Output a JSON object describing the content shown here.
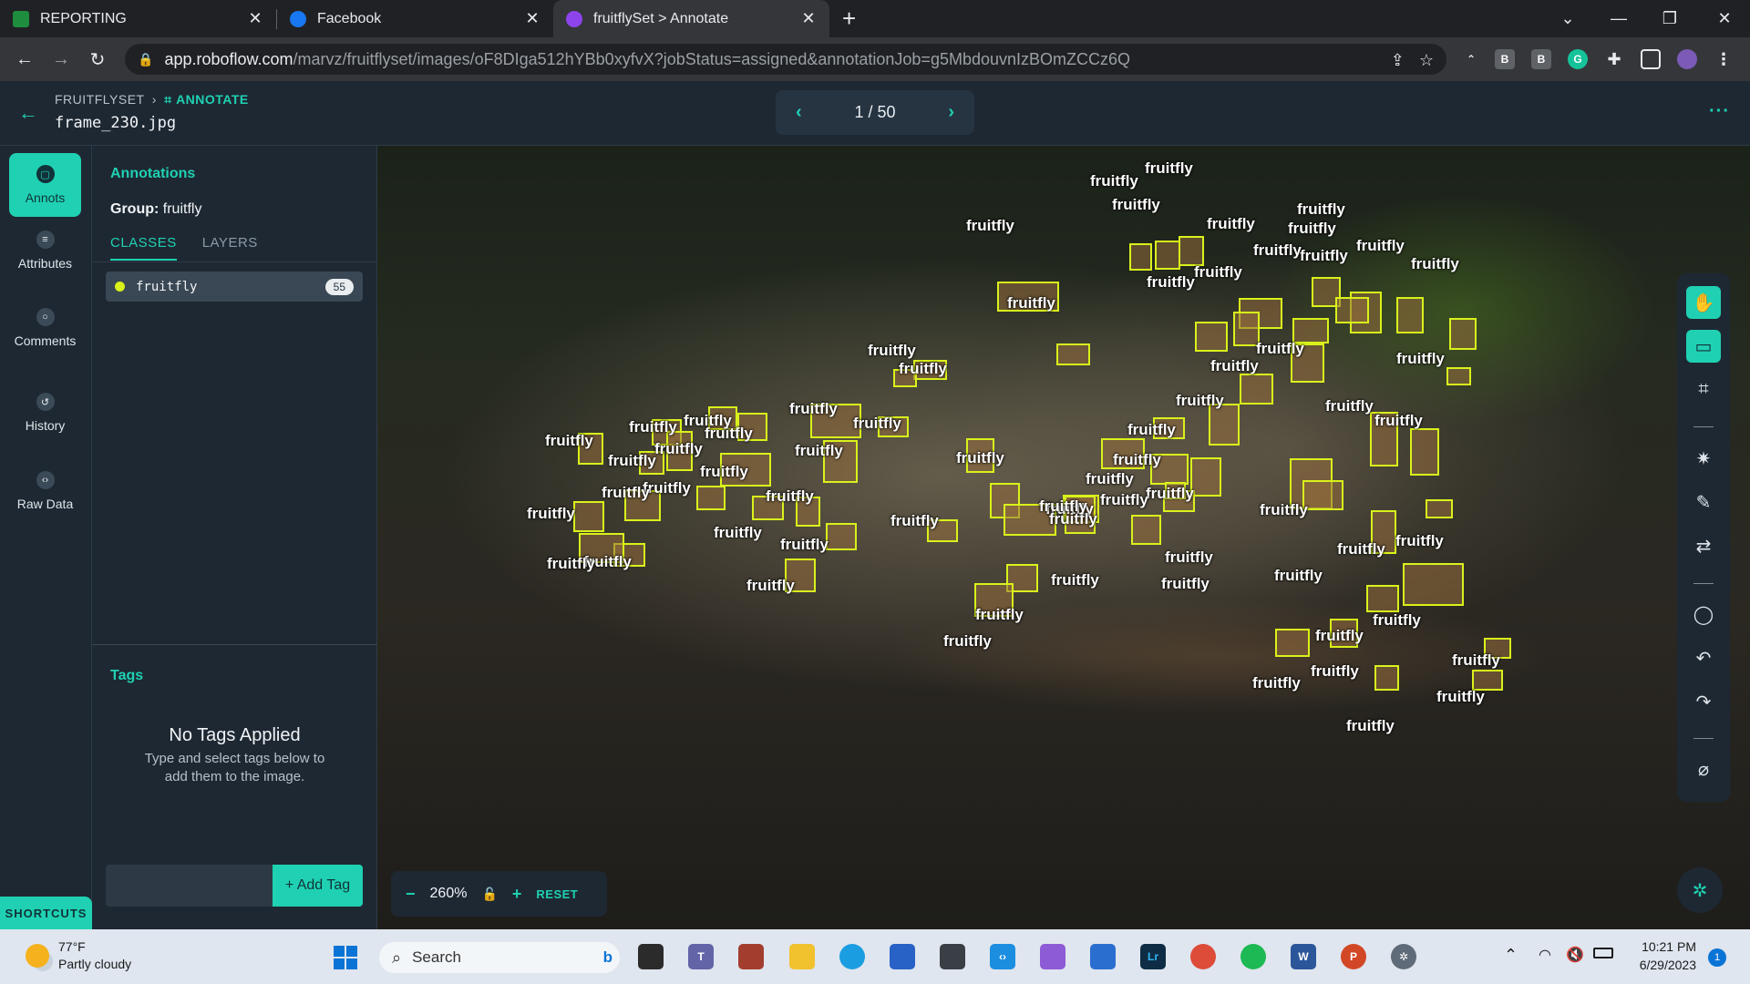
{
  "browser": {
    "tabs": [
      {
        "label": "REPORTING",
        "favicon_color": "#1e8e3e"
      },
      {
        "label": "Facebook",
        "favicon_color": "#1877f2"
      },
      {
        "label": "fruitflySet > Annotate",
        "favicon_color": "#8e44ec"
      }
    ],
    "url_host": "app.roboflow.com",
    "url_path": "/marvz/fruitflyset/images/oF8DIga512hYBb0xyfvX?jobStatus=assigned&annotationJob=g5MbdouvnIzBOmZCCz6Q"
  },
  "header": {
    "project": "FRUITFLYSET",
    "section": "ANNOTATE",
    "filename": "frame_230.jpg",
    "pager": "1 / 50"
  },
  "rail": {
    "items": [
      {
        "label": "Annots",
        "icon": "square-icon"
      },
      {
        "label": "Attributes",
        "icon": "list-icon"
      },
      {
        "label": "Comments",
        "icon": "chat-icon"
      },
      {
        "label": "History",
        "icon": "history-icon"
      },
      {
        "label": "Raw Data",
        "icon": "code-icon"
      }
    ],
    "shortcuts": "SHORTCUTS"
  },
  "panel": {
    "title": "Annotations",
    "group_label": "Group:",
    "group_value": "fruitfly",
    "tab_classes": "CLASSES",
    "tab_layers": "LAYERS",
    "class_name": "fruitfly",
    "class_count": "55",
    "tags_title": "Tags",
    "no_tags": "No Tags Applied",
    "no_tags_sub": "Type and select tags below to add them to the image.",
    "add_tag": "+ Add Tag"
  },
  "canvas": {
    "box_label": "fruitfly",
    "box_color": "#d9f21b"
  },
  "zoom": {
    "value": "260%",
    "reset": "RESET"
  },
  "taskbar": {
    "temp": "77°F",
    "weather": "Partly cloudy",
    "search": "Search",
    "time": "10:21 PM",
    "date": "6/29/2023",
    "notifications": "1"
  }
}
